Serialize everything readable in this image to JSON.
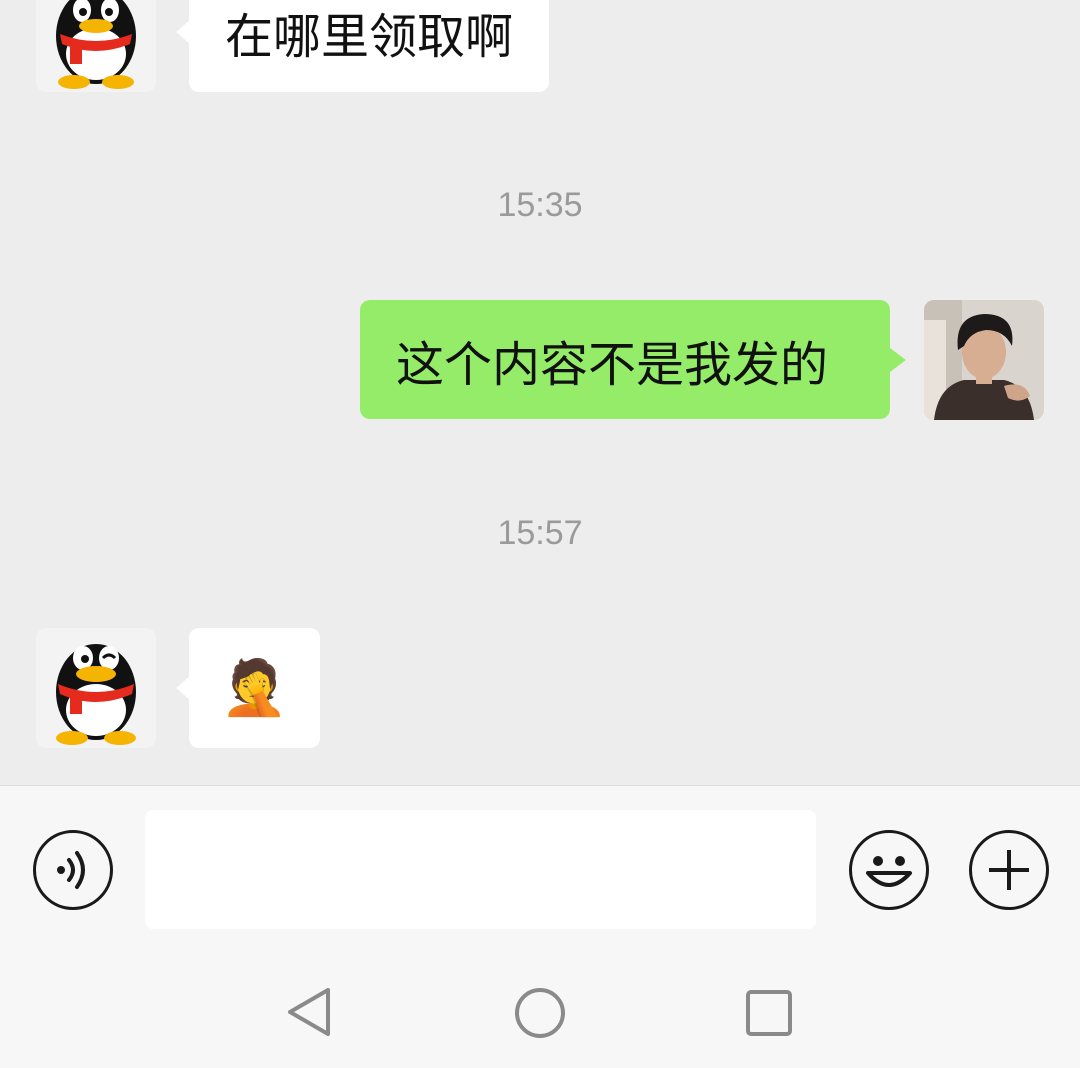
{
  "messages": [
    {
      "direction": "incoming",
      "type": "text",
      "text": "在哪里领取啊"
    },
    {
      "timestamp": "15:35"
    },
    {
      "direction": "outgoing",
      "type": "text",
      "text": "这个内容不是我发的"
    },
    {
      "timestamp": "15:57"
    },
    {
      "direction": "incoming",
      "type": "emoji",
      "text": "🤦"
    }
  ],
  "input": {
    "value": "",
    "placeholder": ""
  },
  "icons": {
    "voice": "voice-icon",
    "emoji": "emoji-icon",
    "more": "plus-icon",
    "back": "back-triangle-icon",
    "home": "home-circle-icon",
    "recents": "recents-square-icon"
  },
  "colors": {
    "chat_background": "#ededed",
    "incoming_bubble": "#ffffff",
    "outgoing_bubble": "#95ec69",
    "timestamp_text": "#9a9a9a",
    "input_bar": "#f7f7f7"
  }
}
